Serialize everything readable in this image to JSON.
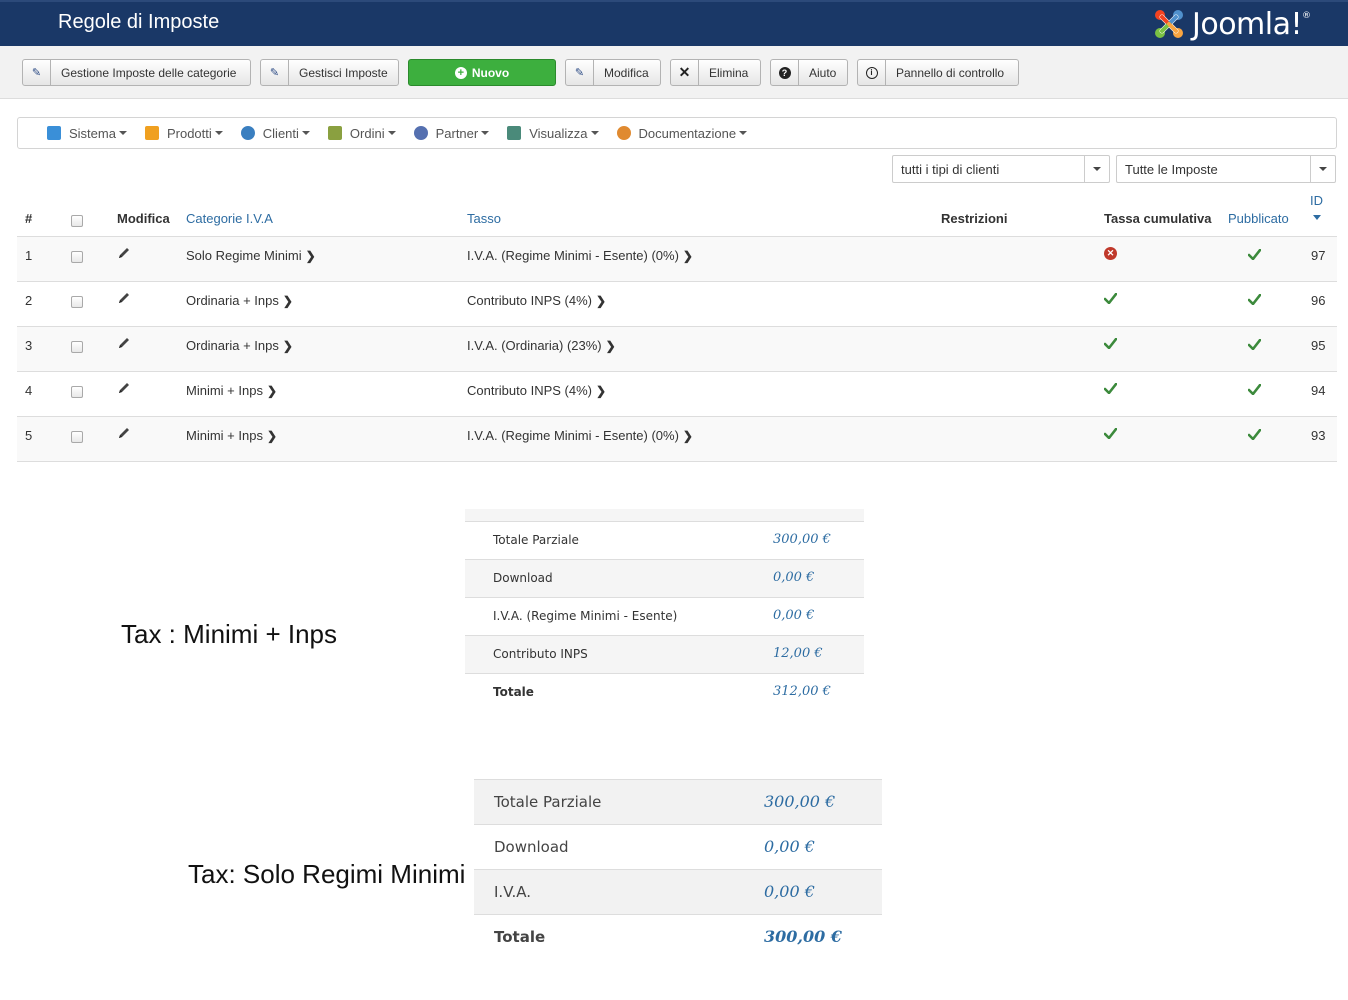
{
  "header": {
    "title": "Regole di Imposte",
    "logo_text": "Joomla!",
    "logo_mark": "®"
  },
  "toolbar": {
    "categories_label": "Gestione Imposte delle categorie",
    "manage_taxes_label": "Gestisci Imposte",
    "new_label": "Nuovo",
    "edit_label": "Modifica",
    "delete_label": "Elimina",
    "help_label": "Aiuto",
    "control_panel_label": "Pannello di controllo"
  },
  "nav": {
    "items": [
      {
        "label": "Sistema",
        "icon": "tools-icon",
        "color": "#3a8fd8"
      },
      {
        "label": "Prodotti",
        "icon": "box-icon",
        "color": "#f0a020"
      },
      {
        "label": "Clienti",
        "icon": "users-icon",
        "color": "#3a7fc0"
      },
      {
        "label": "Ordini",
        "icon": "orders-icon",
        "color": "#8aa040"
      },
      {
        "label": "Partner",
        "icon": "partner-icon",
        "color": "#5570b0"
      },
      {
        "label": "Visualizza",
        "icon": "view-icon",
        "color": "#4a8a7a"
      },
      {
        "label": "Documentazione",
        "icon": "docs-icon",
        "color": "#e08a30"
      }
    ]
  },
  "filters": {
    "customer_type": "tutti i tipi di clienti",
    "taxes": "Tutte le Imposte"
  },
  "table": {
    "headers": {
      "num": "#",
      "edit": "Modifica",
      "category": "Categorie I.V.A",
      "rate": "Tasso",
      "restrictions": "Restrizioni",
      "cumulative": "Tassa cumulativa",
      "published": "Pubblicato",
      "id": "ID"
    },
    "rows": [
      {
        "num": "1",
        "category": "Solo Regime Minimi",
        "rate": "I.V.A. (Regime Minimi - Esente) (0%)",
        "cumulative": false,
        "published": true,
        "id": "97"
      },
      {
        "num": "2",
        "category": "Ordinaria + Inps",
        "rate": "Contributo INPS (4%)",
        "cumulative": true,
        "published": true,
        "id": "96"
      },
      {
        "num": "3",
        "category": "Ordinaria + Inps",
        "rate": "I.V.A. (Ordinaria) (23%)",
        "cumulative": true,
        "published": true,
        "id": "95"
      },
      {
        "num": "4",
        "category": "Minimi + Inps",
        "rate": "Contributo INPS (4%)",
        "cumulative": true,
        "published": true,
        "id": "94"
      },
      {
        "num": "5",
        "category": "Minimi + Inps",
        "rate": "I.V.A. (Regime Minimi - Esente) (0%)",
        "cumulative": true,
        "published": true,
        "id": "93"
      }
    ]
  },
  "captions": {
    "first": "Tax : Minimi + Inps",
    "second": "Tax: Solo Regimi Minimi"
  },
  "summary1": [
    {
      "label": "Totale Parziale",
      "value": "300,00 €"
    },
    {
      "label": "Download",
      "value": "0,00 €"
    },
    {
      "label": "I.V.A. (Regime Minimi - Esente)",
      "value": "0,00 €"
    },
    {
      "label": "Contributo INPS",
      "value": "12,00 €"
    },
    {
      "label": "Totale",
      "value": "312,00 €"
    }
  ],
  "summary2": [
    {
      "label": "Totale Parziale",
      "value": "300,00 €"
    },
    {
      "label": "Download",
      "value": "0,00 €"
    },
    {
      "label": "I.V.A.",
      "value": "0,00 €"
    },
    {
      "label": "Totale",
      "value": "300,00 €"
    }
  ],
  "colors": {
    "header_bg": "#1a3867",
    "new_button": "#3daf3e",
    "link": "#2d6ca2",
    "check": "#3c8a3c",
    "error": "#c0392b"
  }
}
